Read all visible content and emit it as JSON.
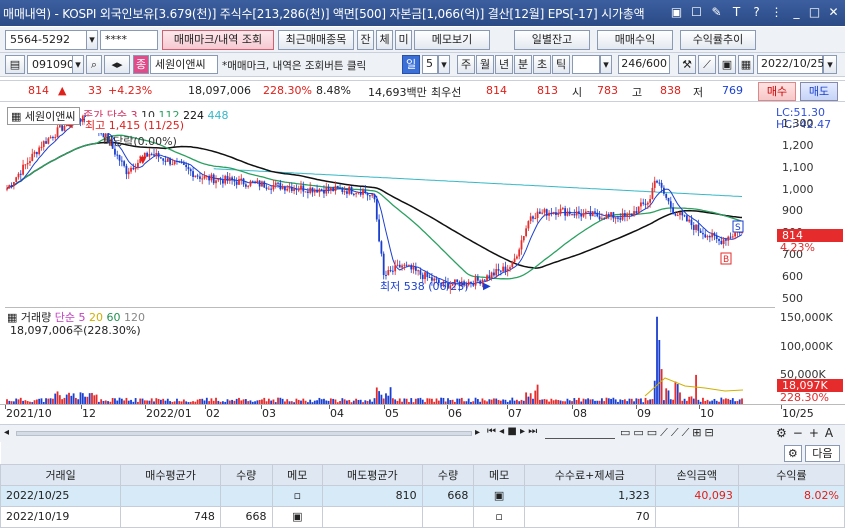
{
  "titlebar": {
    "title": "매매내역) - KOSPI 외국인보유[3.679(천)] 주식수[213,286(천)] 액면[500] 자본금[1,066(억)] 결산[12월] EPS[-17] 시가총액",
    "icons": [
      "window-icon",
      "save-icon",
      "font-icon",
      "help-icon",
      "menu-icon",
      "minimize-icon",
      "maximize-icon",
      "close-icon"
    ]
  },
  "toolbar1": {
    "account": "5564-5292",
    "password": "****",
    "btn_trade_mark": "매매마크/내역 조회",
    "btn_recent": "최근매매종목",
    "btn_jan": "잔",
    "btn_che": "체",
    "btn_mi": "미",
    "btn_memo": "메모보기",
    "btn_daily": "일별잔고",
    "btn_profit": "매매수익",
    "btn_trend": "수익률추이"
  },
  "toolbar2": {
    "code": "091090",
    "stock_name": "세원이앤씨",
    "hint": "*매매마크, 내역은 조회버튼 클릭",
    "period_day": "일",
    "period_n": "5",
    "periods": [
      "주",
      "월",
      "년",
      "분",
      "초",
      "틱"
    ],
    "count": "246",
    "count_total": "/600",
    "date": "2022/10/25"
  },
  "quote": {
    "price": "814",
    "change": "33",
    "change_pct": "+4.23%",
    "volume": "18,097,006",
    "vol_ratio": "228.30%",
    "turnover": "8.48%",
    "amount": "14,693백만",
    "best_label": "최우선",
    "ask": "814",
    "bid": "813",
    "open_label": "시",
    "open": "783",
    "high_label": "고",
    "high": "838",
    "low_label": "저",
    "low": "769",
    "buy_btn": "매수",
    "sell_btn": "매도"
  },
  "price_pane": {
    "legend_name": "세원이앤씨",
    "legend_ma": "종가 단순 3",
    "ma_vals": [
      "10",
      "112",
      "224",
      "448"
    ],
    "high_note": "최고 1,415 (11/25)",
    "div_note": "배당락(0.00%)",
    "low_note": "최저 538 (06/23)",
    "lc": "LC:51.30",
    "hc": "HC:-42.47",
    "yticks": [
      "1,300",
      "1,200",
      "1,100",
      "1,000",
      "900",
      "800",
      "700",
      "600",
      "500"
    ],
    "last_price": "814",
    "last_pct": "4.23%",
    "marker_s": "S",
    "marker_b": "B"
  },
  "vol_pane": {
    "legend_name": "거래량",
    "legend_ma": "단순 5",
    "ma_vals": [
      "20",
      "60",
      "120"
    ],
    "current": "18,097,006주(228.30%)",
    "yticks": [
      "150,000K",
      "100,000K",
      "50,000K"
    ],
    "last_vol": "18,097K",
    "last_ratio": "228.30%"
  },
  "xaxis": {
    "labels": [
      "2021/10",
      "12",
      "2022/01",
      "02",
      "03",
      "04",
      "05",
      "06",
      "07",
      "08",
      "09",
      "10",
      "10/25"
    ]
  },
  "bottom_btns": {
    "next": "다음"
  },
  "table": {
    "headers": [
      "거래일",
      "매수평균가",
      "수량",
      "메모",
      "매도평균가",
      "수량",
      "메모",
      "수수료+제세금",
      "손익금액",
      "수익률"
    ],
    "rows": [
      {
        "date": "2022/10/25",
        "buy_avg": "",
        "buy_qty": "",
        "sell_avg": "810",
        "sell_qty": "668",
        "fee": "1,323",
        "pnl": "40,093",
        "rate": "8.02%"
      },
      {
        "date": "2022/10/19",
        "buy_avg": "748",
        "buy_qty": "668",
        "sell_avg": "",
        "sell_qty": "",
        "fee": "70",
        "pnl": "",
        "rate": ""
      }
    ]
  },
  "chart_data": {
    "type": "candlestick",
    "title": "",
    "ylim": [
      500,
      1400
    ],
    "x": [
      "2021/10",
      "2021/11",
      "2021/12",
      "2022/01",
      "2022/02",
      "2022/03",
      "2022/04",
      "2022/05",
      "2022/06",
      "2022/07",
      "2022/08",
      "2022/09",
      "2022/10"
    ],
    "close_approx": [
      1000,
      1300,
      1150,
      1100,
      1040,
      1030,
      1000,
      990,
      580,
      600,
      880,
      930,
      814
    ],
    "volume_approx_k": [
      6000,
      20000,
      10000,
      8000,
      6000,
      5000,
      5000,
      15000,
      8000,
      5000,
      25000,
      150000,
      18097
    ]
  }
}
